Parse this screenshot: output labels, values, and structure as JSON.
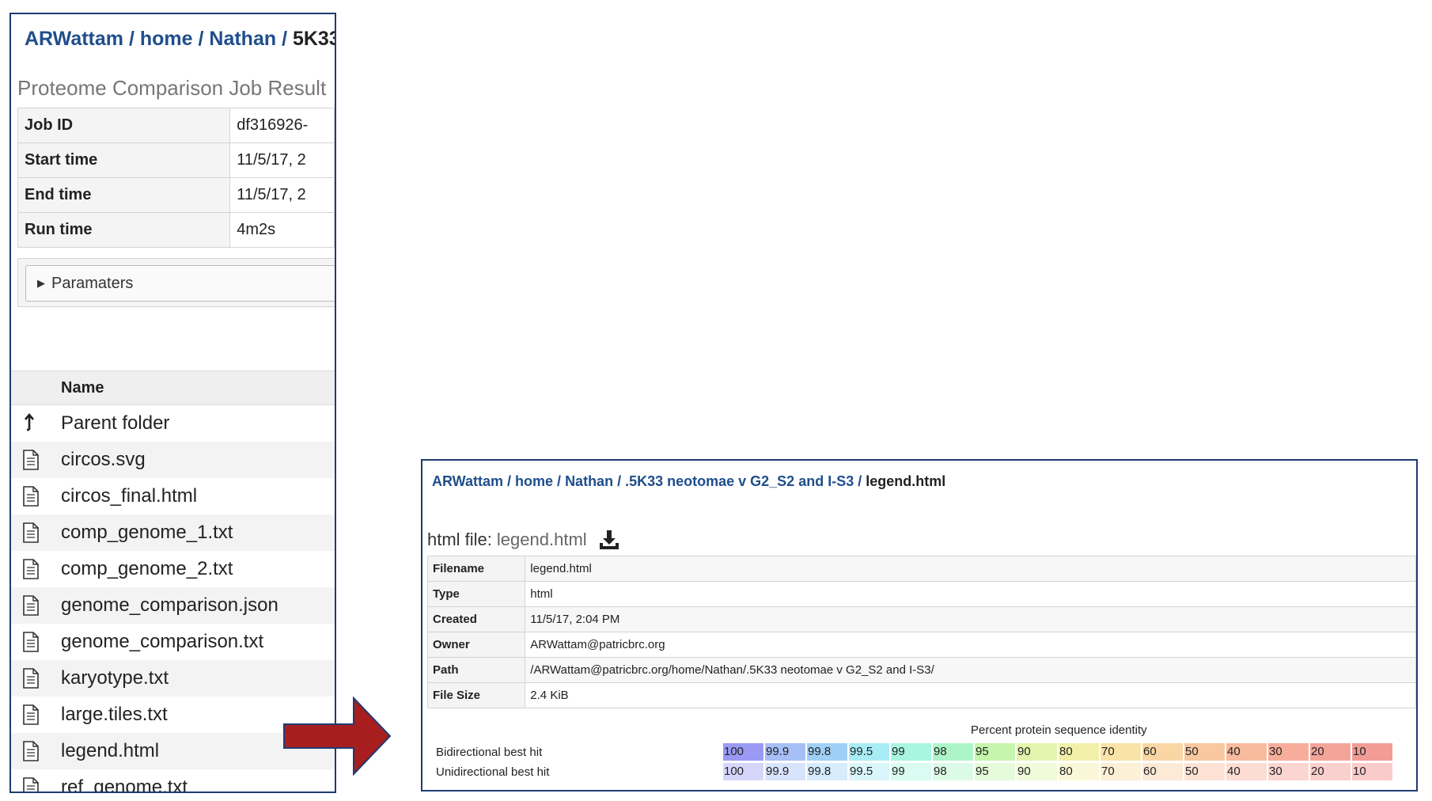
{
  "left": {
    "breadcrumb": {
      "part1": "ARWattam",
      "sep1": " / ",
      "part2": "home",
      "sep2": " / ",
      "part3": "Nathan",
      "sep3": " / ",
      "current": "5K33"
    },
    "result_title": "Proteome Comparison Job Result",
    "job_table": [
      {
        "key": "Job ID",
        "value": "df316926-"
      },
      {
        "key": "Start time",
        "value": "11/5/17, 2"
      },
      {
        "key": "End time",
        "value": "11/5/17, 2"
      },
      {
        "key": "Run time",
        "value": "4m2s"
      }
    ],
    "params_label": "Paramaters",
    "name_header": "Name",
    "parent_folder": "Parent folder",
    "files": [
      "circos.svg",
      "circos_final.html",
      "comp_genome_1.txt",
      "comp_genome_2.txt",
      "genome_comparison.json",
      "genome_comparison.txt",
      "karyotype.txt",
      "large.tiles.txt",
      "legend.html",
      "ref_genome.txt"
    ]
  },
  "right": {
    "breadcrumb": {
      "part1": "ARWattam",
      "sep1": " / ",
      "part2": "home",
      "sep2": " / ",
      "part3": "Nathan",
      "sep3": " / ",
      "part4": ".5K33 neotomae v G2_S2 and I-S3",
      "sep4": " / ",
      "current": "legend.html"
    },
    "html_file_label": "html file:",
    "html_file_name": "legend.html",
    "metadata": [
      {
        "key": "Filename",
        "value": "legend.html"
      },
      {
        "key": "Type",
        "value": "html"
      },
      {
        "key": "Created",
        "value": "11/5/17, 2:04 PM"
      },
      {
        "key": "Owner",
        "value": "ARWattam@patricbrc.org"
      },
      {
        "key": "Path",
        "value": "/ARWattam@patricbrc.org/home/Nathan/.5K33 neotomae v G2_S2 and I-S3/"
      },
      {
        "key": "File Size",
        "value": "2.4 KiB"
      }
    ],
    "legend": {
      "title": "Percent protein sequence identity",
      "levels": [
        "100",
        "99.9",
        "99.8",
        "99.5",
        "99",
        "98",
        "95",
        "90",
        "80",
        "70",
        "60",
        "50",
        "40",
        "30",
        "20",
        "10"
      ],
      "rows": [
        {
          "label": "Bidirectional best hit",
          "colors": [
            "#9a9af5",
            "#a6bff7",
            "#9fd0f7",
            "#a9ecf5",
            "#a8f5e0",
            "#adf5c8",
            "#c6f5ad",
            "#e2f5ad",
            "#f3f0a9",
            "#f9e3a6",
            "#fad6a4",
            "#f9c8a0",
            "#f8bb9d",
            "#f6ae9b",
            "#f5a49a",
            "#f29c96"
          ]
        },
        {
          "label": "Unidirectional best hit",
          "colors": [
            "#d6d6fb",
            "#d8e4fc",
            "#d6ebfc",
            "#d9f6fb",
            "#d9fbf1",
            "#dcfbe7",
            "#e5fbd9",
            "#f0fbd9",
            "#f9f7d7",
            "#fcf0d6",
            "#fcead6",
            "#fce3d5",
            "#fcdcd3",
            "#fbd5d1",
            "#fad0cf",
            "#f9cccb"
          ]
        }
      ]
    }
  }
}
